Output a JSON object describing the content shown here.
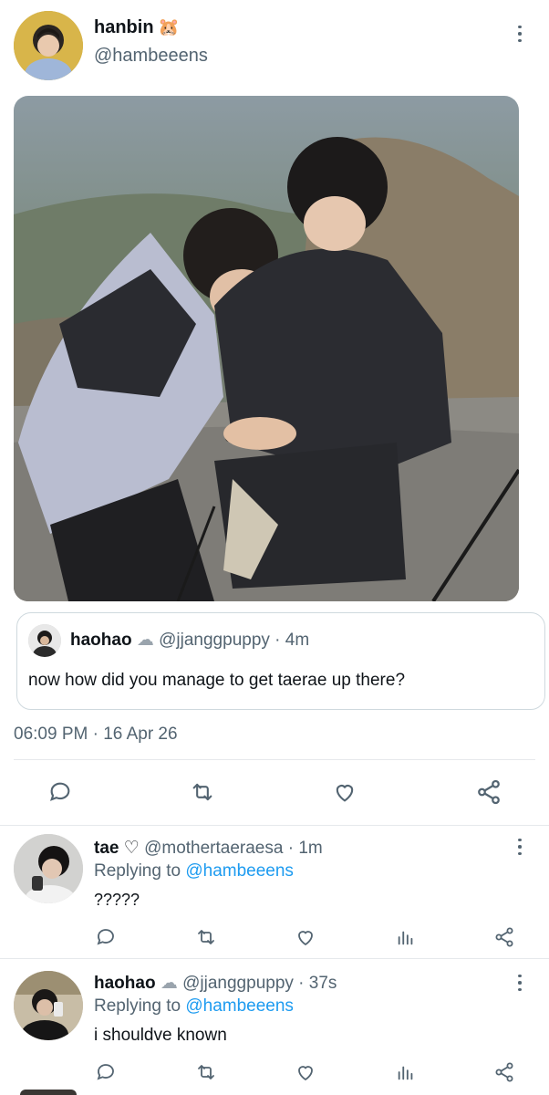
{
  "tweet": {
    "author_name": "hanbin",
    "author_emoji": "🐹",
    "author_handle": "@hambeeens",
    "timestamp": "06:09 PM · 16 Apr 26"
  },
  "quote": {
    "name": "haohao",
    "cloud": "☁",
    "handle": "@jjanggpuppy · 4m",
    "text": "now how did you manage to get taerae up there?"
  },
  "replies": [
    {
      "name": "tae",
      "heart": "♡",
      "handle": "@mothertaeraesa · 1m",
      "replying_prefix": "Replying to",
      "replying_to": "@hambeeens",
      "text": "?????"
    },
    {
      "name": "haohao",
      "cloud": "☁",
      "handle": "@jjanggpuppy · 37s",
      "replying_prefix": "Replying to",
      "replying_to": "@hambeeens",
      "text": "i shouldve known"
    }
  ],
  "colors": {
    "text": "#0f1419",
    "muted": "#536471",
    "link": "#1d9bf0",
    "divider": "#e6e9ec"
  },
  "icons": [
    "more-icon",
    "reply-icon",
    "retweet-icon",
    "like-icon",
    "share-icon",
    "views-icon"
  ]
}
